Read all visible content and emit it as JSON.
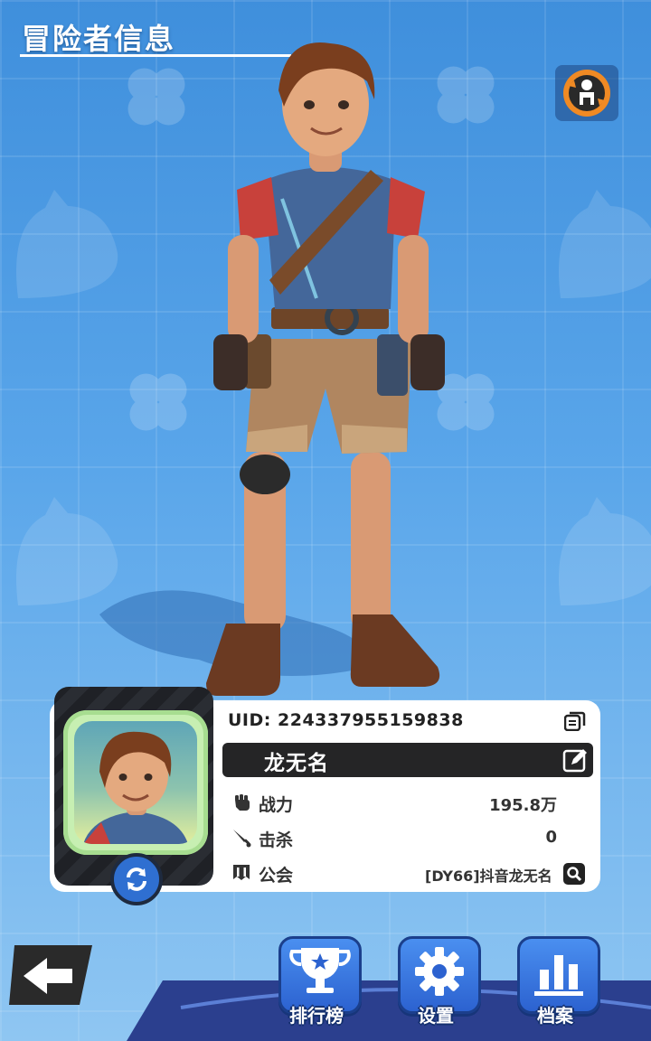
{
  "page": {
    "title": "冒险者信息"
  },
  "player": {
    "uid_label": "UID:",
    "uid": "224337955159838",
    "name": "龙无名",
    "stats": [
      {
        "label": "战力",
        "value": "195.8万",
        "icon": "fist-icon"
      },
      {
        "label": "击杀",
        "value": "0",
        "icon": "sword-icon"
      },
      {
        "label": "公会",
        "value": "[DY66]抖音龙无名",
        "icon": "guild-banner-icon"
      }
    ]
  },
  "nav": {
    "buttons": [
      {
        "label": "排行榜",
        "icon": "trophy-icon"
      },
      {
        "label": "设置",
        "icon": "gear-icon"
      },
      {
        "label": "档案",
        "icon": "bar-chart-icon"
      }
    ]
  },
  "colors": {
    "background": "#4a9be3",
    "nav_button": "#3a7ee6",
    "card": "#ffffff",
    "name_bar": "#252526"
  }
}
